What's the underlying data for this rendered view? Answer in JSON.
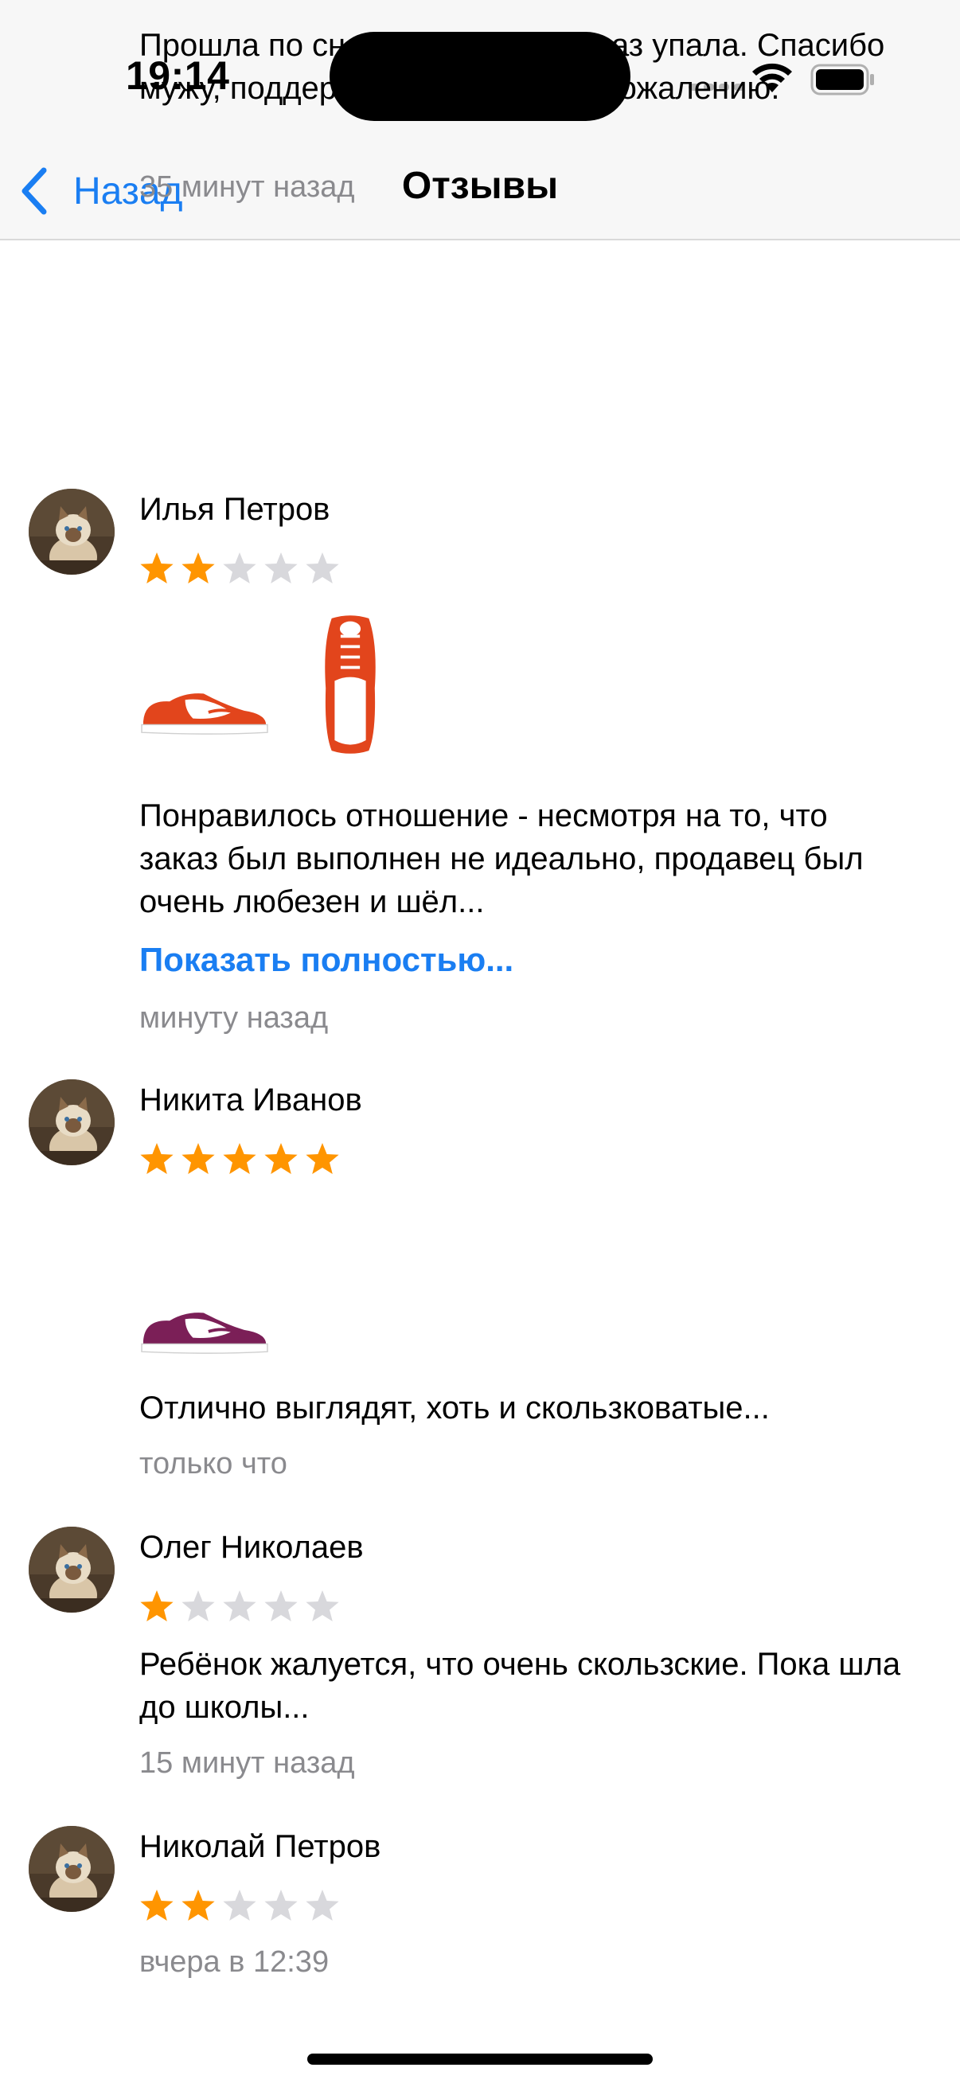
{
  "status_bar": {
    "time": "19:14",
    "signal_icon": "cellular-dots",
    "wifi_icon": "wifi",
    "battery_icon": "battery-full"
  },
  "nav": {
    "back_label": "Назад",
    "back_icon": "chevron-left",
    "title": "Отзывы"
  },
  "colors": {
    "accent": "#1a7ef2",
    "star_filled": "#ff9500",
    "star_empty": "#d8d8dc",
    "secondary_text": "#8a8a8e"
  },
  "reviews": [
    {
      "text": "Прошла по снегу 30 метров, 5 раз упала. Спасибо мужу, поддерживал. Возврат, к сожалению.",
      "time": "35 минут назад"
    },
    {
      "author": "Илья Петров",
      "rating": 2,
      "photos": [
        "orange-sneaker-side",
        "orange-sneaker-top"
      ],
      "text": "Понравилось отношение - несмотря на то, что заказ был выполнен не идеально, продавец был очень любезен и шёл...",
      "show_more": "Показать полностью...",
      "time": "минуту назад"
    },
    {
      "author": "Никита Иванов",
      "rating": 5,
      "photos": [
        "purple-sneaker-side"
      ],
      "text": "Отлично выглядят, хоть и скользковатые...",
      "time": "только что"
    },
    {
      "author": "Олег Николаев",
      "rating": 1,
      "text": "Ребёнок жалуется, что очень скользские. Пока шла до школы...",
      "time": "15 минут назад"
    },
    {
      "author": "Николай Петров",
      "rating": 2,
      "time": "вчера в 12:39"
    }
  ]
}
